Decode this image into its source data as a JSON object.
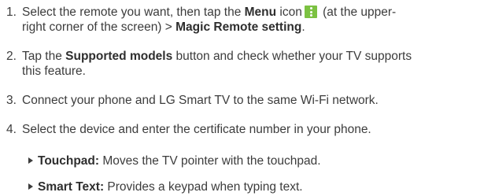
{
  "steps": [
    {
      "num": "1.",
      "a": "Select the remote you want, then tap the ",
      "menu_bold": "Menu",
      "b": " icon",
      "c": " (at the upper-",
      "d": "right corner of the screen) > ",
      "magic_bold": "Magic Remote setting",
      "e": ".",
      "icon": "menu-dots-icon",
      "icon_color": "#7cc242"
    },
    {
      "num": "2.",
      "a": "Tap the ",
      "bold": "Supported models",
      "b": " button and check whether your TV supports",
      "c": "this feature."
    },
    {
      "num": "3.",
      "text": "Connect your phone and LG Smart TV to the same Wi-Fi network."
    },
    {
      "num": "4.",
      "text": "Select the device and enter the certificate number in your phone."
    }
  ],
  "bullets": [
    {
      "bold": "Touchpad:",
      "text": " Moves the TV pointer with the touchpad."
    },
    {
      "bold": "Smart Text:",
      "text": " Provides a keypad when typing text."
    }
  ]
}
